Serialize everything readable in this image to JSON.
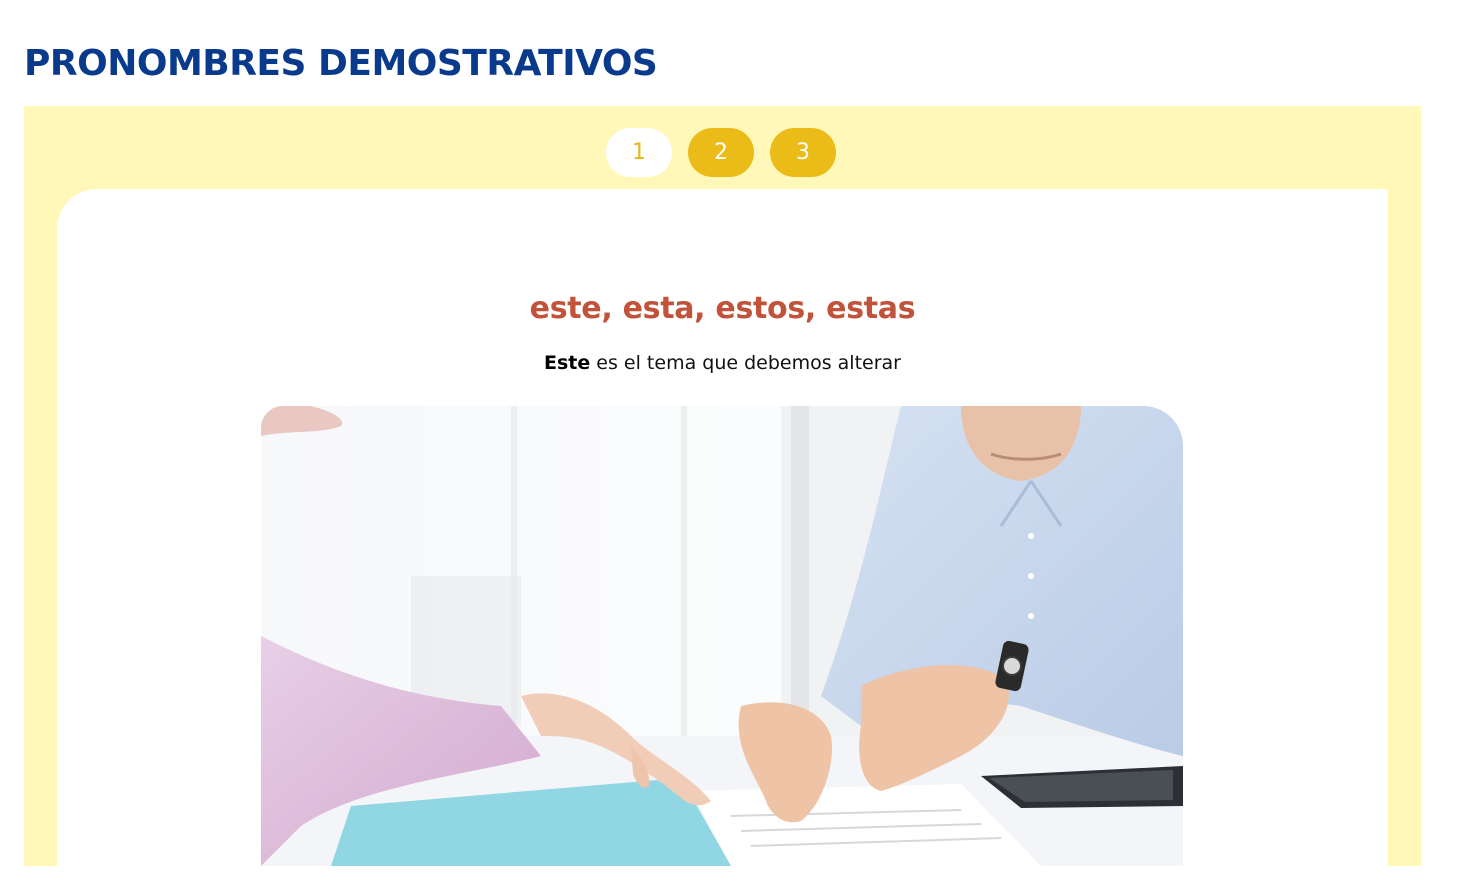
{
  "header": {
    "title": "PRONOMBRES DEMOSTRATIVOS"
  },
  "pager": {
    "pages": [
      "1",
      "2",
      "3"
    ],
    "active_index": 0
  },
  "slide": {
    "heading": "este, esta, estos, estas",
    "example_bold": "Este",
    "example_rest": " es el tema que debemos alterar",
    "image": {
      "icon": "photo-two-people-pointing-at-document"
    }
  },
  "colors": {
    "title": "#0a3a8c",
    "panel_bg": "#fff8b8",
    "pager_inactive": "#ebbb18",
    "pager_active_text": "#e8b818",
    "heading": "#c0533a"
  }
}
